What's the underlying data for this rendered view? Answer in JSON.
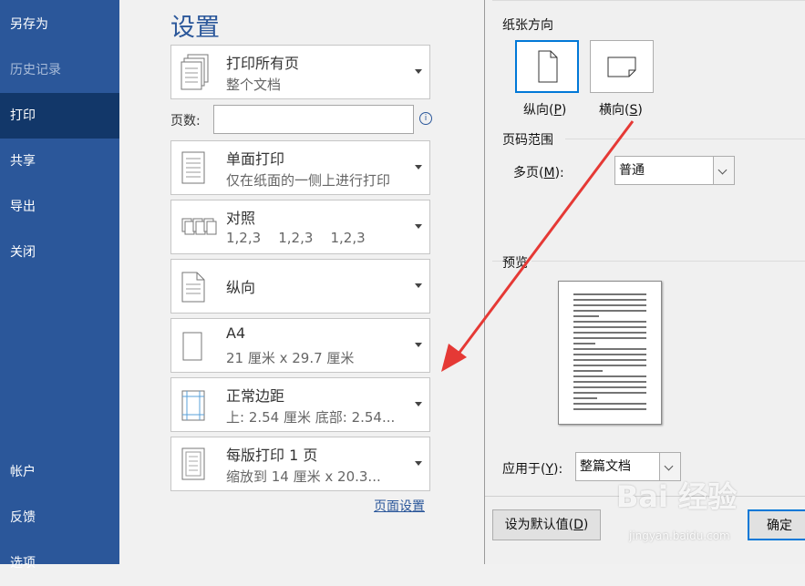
{
  "sidebar": {
    "items": [
      {
        "label": "另存为"
      },
      {
        "label": "历史记录"
      },
      {
        "label": "打印"
      },
      {
        "label": "共享"
      },
      {
        "label": "导出"
      },
      {
        "label": "关闭"
      },
      {
        "label": "帐户"
      },
      {
        "label": "反馈"
      },
      {
        "label": "选项"
      }
    ]
  },
  "settings": {
    "title": "设置",
    "pages_label": "页数:",
    "pages_value": "",
    "info_glyph": "i",
    "options": [
      {
        "line1": "打印所有页",
        "line2": "整个文档",
        "icon": "pages-icon"
      },
      {
        "line1": "单面打印",
        "line2": "仅在纸面的一侧上进行打印",
        "icon": "one-sided-icon"
      },
      {
        "line1": "对照",
        "line2": "1,2,3    1,2,3    1,2,3",
        "icon": "collate-icon"
      },
      {
        "line1": "纵向",
        "line2": "",
        "icon": "portrait-icon"
      },
      {
        "line1": "A4",
        "line2": "21 厘米 x 29.7 厘米",
        "icon": "paper-size-icon"
      },
      {
        "line1": "正常边距",
        "line2": "上: 2.54 厘米 底部: 2.54...",
        "icon": "margins-icon"
      },
      {
        "line1": "每版打印 1 页",
        "line2": "缩放到 14 厘米 x 20.3...",
        "icon": "pages-per-sheet-icon"
      }
    ],
    "page_setup_link": "页面设置"
  },
  "dialog": {
    "orientation_label": "纸张方向",
    "portrait": {
      "text": "纵向(",
      "key": "P",
      "end": ")"
    },
    "landscape": {
      "text": "横向(",
      "key": "S",
      "end": ")"
    },
    "page_range_label": "页码范围",
    "multiple_pages": {
      "text": "多页(",
      "key": "M",
      "end": "):"
    },
    "multiple_pages_value": "普通",
    "preview_label": "预览",
    "apply_to": {
      "text": "应用于(",
      "key": "Y",
      "end": "):"
    },
    "apply_to_value": "整篇文档",
    "set_default": {
      "text": "设为默认值(",
      "key": "D",
      "end": ")"
    },
    "ok_label": "确定"
  },
  "watermark": {
    "main": "Bai 经验",
    "sub": "jingyan.baidu.com"
  },
  "colors": {
    "sidebar": "#2b579a",
    "active": "#123769",
    "arrow": "#e53935",
    "accent": "#0078d7"
  }
}
